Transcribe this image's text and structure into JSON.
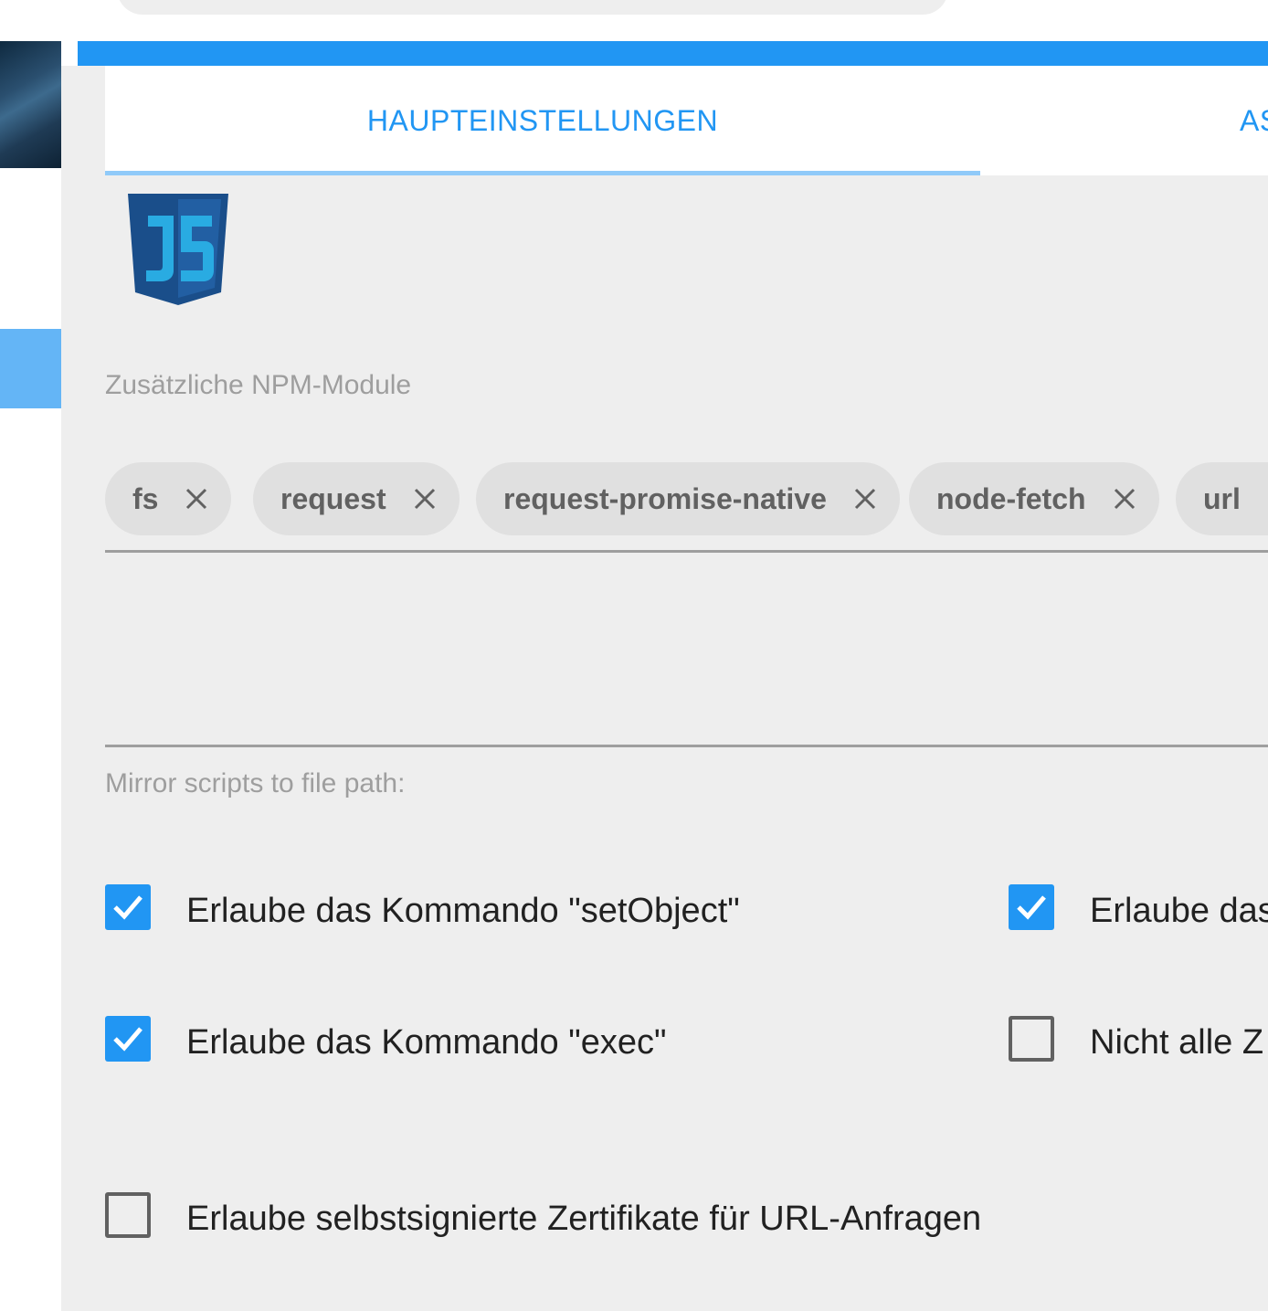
{
  "sidebar": {},
  "tabs": [
    {
      "label": "HAUPTEINSTELLUNGEN"
    },
    {
      "label": "AS"
    }
  ],
  "npm_modules": {
    "label": "Zusätzliche NPM-Module",
    "chips": [
      {
        "label": "fs"
      },
      {
        "label": "request"
      },
      {
        "label": "request-promise-native"
      },
      {
        "label": "node-fetch"
      },
      {
        "label": "url"
      }
    ]
  },
  "mirror": {
    "label": "Mirror scripts to file path:"
  },
  "options": {
    "setobject": {
      "label": "Erlaube das Kommando \"setObject\"",
      "checked": true
    },
    "second_col_top": {
      "label": "Erlaube das",
      "checked": true
    },
    "exec": {
      "label": "Erlaube das Kommando \"exec\"",
      "checked": true
    },
    "second_col_bottom": {
      "label": "Nicht alle Z",
      "checked": false
    },
    "selfsigned": {
      "label": "Erlaube selbstsignierte Zertifikate für URL-Anfragen",
      "checked": false
    }
  },
  "colors": {
    "accent": "#2196f3",
    "panel": "#eeeeee",
    "chip": "#e0e0e0"
  }
}
